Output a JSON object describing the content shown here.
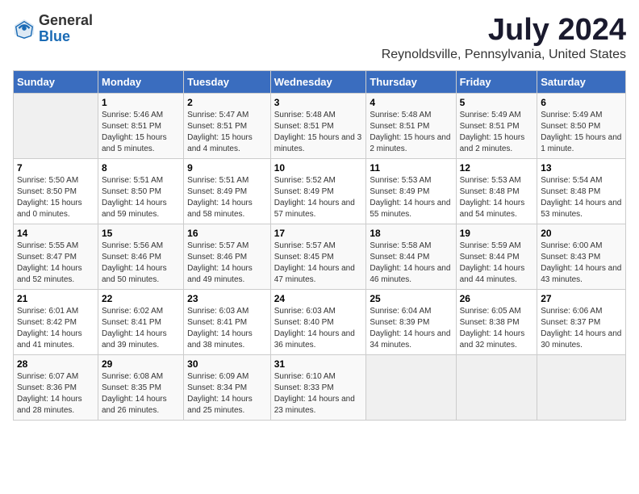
{
  "logo": {
    "general": "General",
    "blue": "Blue"
  },
  "title": "July 2024",
  "subtitle": "Reynoldsville, Pennsylvania, United States",
  "days_of_week": [
    "Sunday",
    "Monday",
    "Tuesday",
    "Wednesday",
    "Thursday",
    "Friday",
    "Saturday"
  ],
  "weeks": [
    [
      {
        "day": "",
        "sunrise": "",
        "sunset": "",
        "daylight": "",
        "empty": true
      },
      {
        "day": "1",
        "sunrise": "5:46 AM",
        "sunset": "8:51 PM",
        "daylight": "15 hours and 5 minutes."
      },
      {
        "day": "2",
        "sunrise": "5:47 AM",
        "sunset": "8:51 PM",
        "daylight": "15 hours and 4 minutes."
      },
      {
        "day": "3",
        "sunrise": "5:48 AM",
        "sunset": "8:51 PM",
        "daylight": "15 hours and 3 minutes."
      },
      {
        "day": "4",
        "sunrise": "5:48 AM",
        "sunset": "8:51 PM",
        "daylight": "15 hours and 2 minutes."
      },
      {
        "day": "5",
        "sunrise": "5:49 AM",
        "sunset": "8:51 PM",
        "daylight": "15 hours and 2 minutes."
      },
      {
        "day": "6",
        "sunrise": "5:49 AM",
        "sunset": "8:50 PM",
        "daylight": "15 hours and 1 minute."
      }
    ],
    [
      {
        "day": "7",
        "sunrise": "5:50 AM",
        "sunset": "8:50 PM",
        "daylight": "15 hours and 0 minutes."
      },
      {
        "day": "8",
        "sunrise": "5:51 AM",
        "sunset": "8:50 PM",
        "daylight": "14 hours and 59 minutes."
      },
      {
        "day": "9",
        "sunrise": "5:51 AM",
        "sunset": "8:49 PM",
        "daylight": "14 hours and 58 minutes."
      },
      {
        "day": "10",
        "sunrise": "5:52 AM",
        "sunset": "8:49 PM",
        "daylight": "14 hours and 57 minutes."
      },
      {
        "day": "11",
        "sunrise": "5:53 AM",
        "sunset": "8:49 PM",
        "daylight": "14 hours and 55 minutes."
      },
      {
        "day": "12",
        "sunrise": "5:53 AM",
        "sunset": "8:48 PM",
        "daylight": "14 hours and 54 minutes."
      },
      {
        "day": "13",
        "sunrise": "5:54 AM",
        "sunset": "8:48 PM",
        "daylight": "14 hours and 53 minutes."
      }
    ],
    [
      {
        "day": "14",
        "sunrise": "5:55 AM",
        "sunset": "8:47 PM",
        "daylight": "14 hours and 52 minutes."
      },
      {
        "day": "15",
        "sunrise": "5:56 AM",
        "sunset": "8:46 PM",
        "daylight": "14 hours and 50 minutes."
      },
      {
        "day": "16",
        "sunrise": "5:57 AM",
        "sunset": "8:46 PM",
        "daylight": "14 hours and 49 minutes."
      },
      {
        "day": "17",
        "sunrise": "5:57 AM",
        "sunset": "8:45 PM",
        "daylight": "14 hours and 47 minutes."
      },
      {
        "day": "18",
        "sunrise": "5:58 AM",
        "sunset": "8:44 PM",
        "daylight": "14 hours and 46 minutes."
      },
      {
        "day": "19",
        "sunrise": "5:59 AM",
        "sunset": "8:44 PM",
        "daylight": "14 hours and 44 minutes."
      },
      {
        "day": "20",
        "sunrise": "6:00 AM",
        "sunset": "8:43 PM",
        "daylight": "14 hours and 43 minutes."
      }
    ],
    [
      {
        "day": "21",
        "sunrise": "6:01 AM",
        "sunset": "8:42 PM",
        "daylight": "14 hours and 41 minutes."
      },
      {
        "day": "22",
        "sunrise": "6:02 AM",
        "sunset": "8:41 PM",
        "daylight": "14 hours and 39 minutes."
      },
      {
        "day": "23",
        "sunrise": "6:03 AM",
        "sunset": "8:41 PM",
        "daylight": "14 hours and 38 minutes."
      },
      {
        "day": "24",
        "sunrise": "6:03 AM",
        "sunset": "8:40 PM",
        "daylight": "14 hours and 36 minutes."
      },
      {
        "day": "25",
        "sunrise": "6:04 AM",
        "sunset": "8:39 PM",
        "daylight": "14 hours and 34 minutes."
      },
      {
        "day": "26",
        "sunrise": "6:05 AM",
        "sunset": "8:38 PM",
        "daylight": "14 hours and 32 minutes."
      },
      {
        "day": "27",
        "sunrise": "6:06 AM",
        "sunset": "8:37 PM",
        "daylight": "14 hours and 30 minutes."
      }
    ],
    [
      {
        "day": "28",
        "sunrise": "6:07 AM",
        "sunset": "8:36 PM",
        "daylight": "14 hours and 28 minutes."
      },
      {
        "day": "29",
        "sunrise": "6:08 AM",
        "sunset": "8:35 PM",
        "daylight": "14 hours and 26 minutes."
      },
      {
        "day": "30",
        "sunrise": "6:09 AM",
        "sunset": "8:34 PM",
        "daylight": "14 hours and 25 minutes."
      },
      {
        "day": "31",
        "sunrise": "6:10 AM",
        "sunset": "8:33 PM",
        "daylight": "14 hours and 23 minutes."
      },
      {
        "day": "",
        "sunrise": "",
        "sunset": "",
        "daylight": "",
        "empty": true
      },
      {
        "day": "",
        "sunrise": "",
        "sunset": "",
        "daylight": "",
        "empty": true
      },
      {
        "day": "",
        "sunrise": "",
        "sunset": "",
        "daylight": "",
        "empty": true
      }
    ]
  ],
  "labels": {
    "sunrise": "Sunrise:",
    "sunset": "Sunset:",
    "daylight": "Daylight:"
  }
}
